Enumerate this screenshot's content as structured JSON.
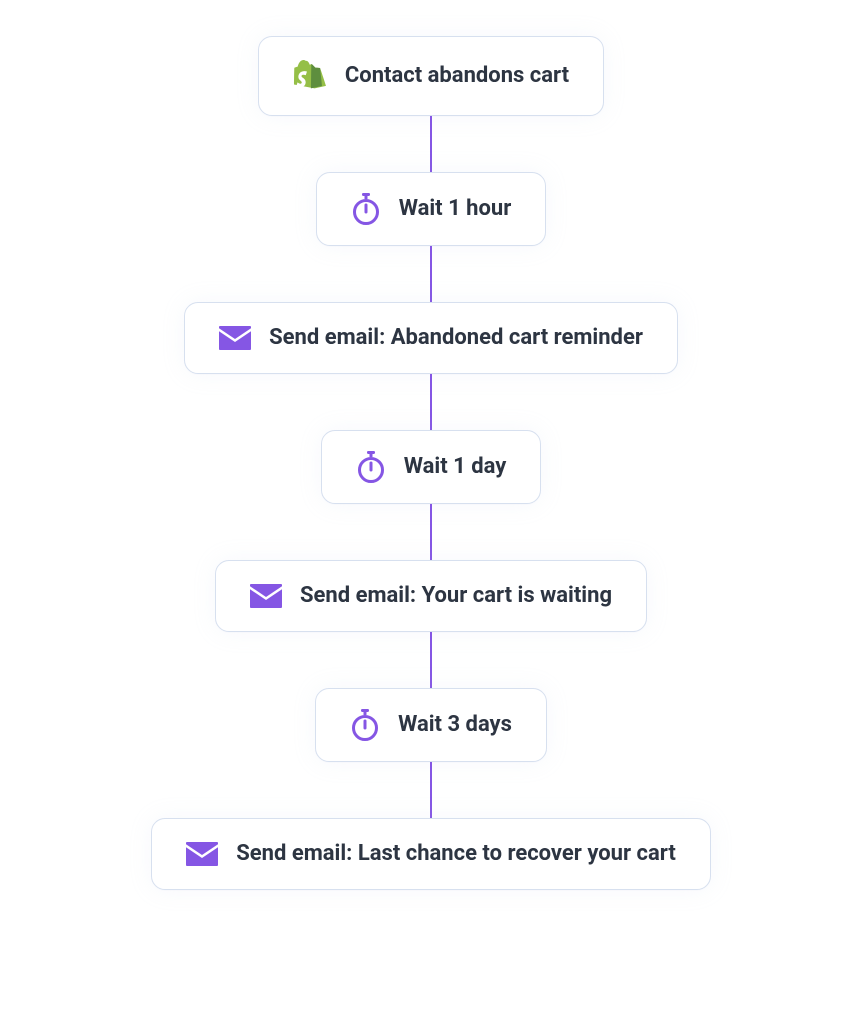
{
  "colors": {
    "accent": "#8556e4",
    "text": "#2d3542",
    "border": "#d7e0ef",
    "shopify": "#95bf47",
    "shopify_dark": "#5e8e3e"
  },
  "nodes": [
    {
      "type": "trigger",
      "icon": "shopify-bag-icon",
      "label": "Contact abandons cart"
    },
    {
      "type": "wait",
      "icon": "stopwatch-icon",
      "label": "Wait 1 hour"
    },
    {
      "type": "email",
      "icon": "email-icon",
      "label": "Send email: Abandoned cart reminder"
    },
    {
      "type": "wait",
      "icon": "stopwatch-icon",
      "label": "Wait 1 day"
    },
    {
      "type": "email",
      "icon": "email-icon",
      "label": "Send email: Your cart is waiting"
    },
    {
      "type": "wait",
      "icon": "stopwatch-icon",
      "label": "Wait 3 days"
    },
    {
      "type": "email",
      "icon": "email-icon",
      "label": "Send email: Last chance to recover your cart"
    }
  ]
}
